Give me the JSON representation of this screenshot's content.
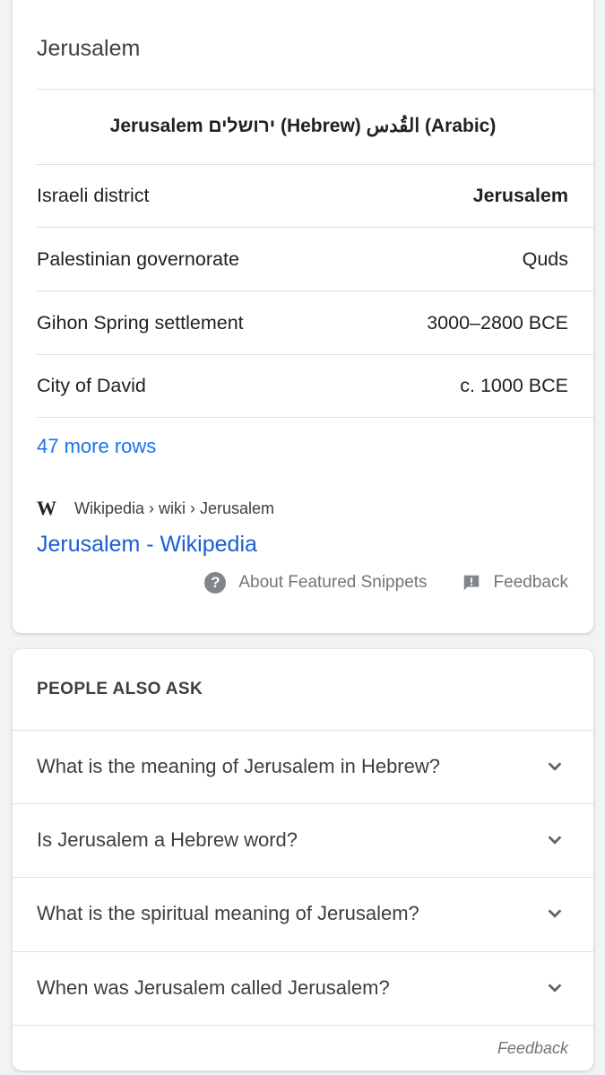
{
  "featured": {
    "title": "Jerusalem",
    "names_caption": "Jerusalem ירושלים (Hebrew) القُدس (Arabic)",
    "rows": [
      {
        "label": "Israeli district",
        "value": "Jerusalem"
      },
      {
        "label": "Palestinian governorate",
        "value": "Quds"
      },
      {
        "label": "Gihon Spring settlement",
        "value": "3000–2800 BCE"
      },
      {
        "label": "City of David",
        "value": "c. 1000 BCE"
      }
    ],
    "more_rows": "47 more rows",
    "source_logo": "W",
    "source_path": "Wikipedia › wiki › Jerusalem",
    "link_title": "Jerusalem - Wikipedia",
    "about_label": "About Featured Snippets",
    "feedback_label": "Feedback",
    "icons": {
      "about": "question-circle-icon",
      "feedback": "feedback-flag-icon"
    }
  },
  "people_also_ask": {
    "heading": "PEOPLE ALSO ASK",
    "questions": [
      "What is the meaning of Jerusalem in Hebrew?",
      "Is Jerusalem a Hebrew word?",
      "What is the spiritual meaning of Jerusalem?",
      "When was Jerusalem called Jerusalem?"
    ],
    "feedback_label": "Feedback"
  },
  "colors": {
    "link": "#1a5fd1",
    "more": "#1a73e8",
    "text": "#202124",
    "muted": "#70757a"
  }
}
